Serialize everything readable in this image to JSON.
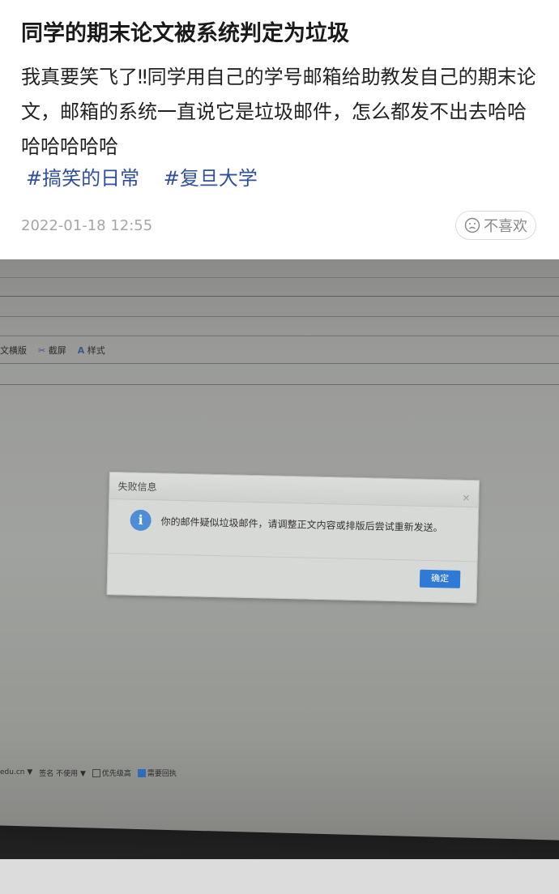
{
  "post": {
    "title": "同学的期末论文被系统判定为垃圾",
    "body": "我真要笑飞了‼同学用自己的学号邮箱给助教发自己的期末论文，邮箱的系统一直说它是垃圾邮件，怎么都发不出去哈哈哈哈哈哈哈",
    "hashtags": [
      "#搞笑的日常",
      "#复旦大学"
    ],
    "timestamp": "2022-01-18 12:55",
    "dislike_label": "不喜欢"
  },
  "photo": {
    "toolbar": {
      "items": [
        {
          "label": "文横版",
          "icon": "text-layout-icon"
        },
        {
          "label": "截屏",
          "icon": "screenshot-icon"
        },
        {
          "label": "样式",
          "icon": "font-style-icon"
        }
      ]
    },
    "dialog": {
      "title": "失败信息",
      "icon": "info-icon",
      "message": "你的邮件疑似垃圾邮件，请调整正文内容或排版后尝试重新发送。",
      "confirm_label": "确定"
    },
    "bottom_bar": {
      "account": "edu.cn ▼",
      "signature": "签名 不使用 ▼",
      "option1": "优先级高",
      "option2": "需要回执"
    },
    "colors": {
      "accent": "#2f7ad6",
      "hashtag": "#2f4f9e"
    }
  }
}
